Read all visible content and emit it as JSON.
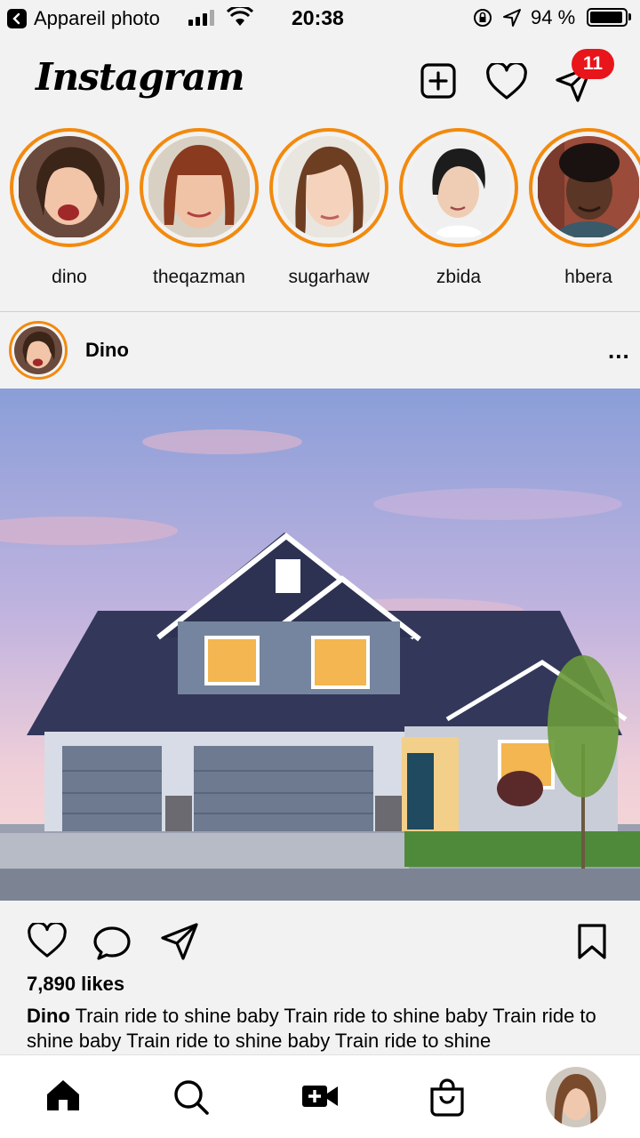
{
  "status_bar": {
    "back_app_label": "Appareil photo",
    "time": "20:38",
    "battery_percent": "94 %",
    "battery_level": 0.94
  },
  "header": {
    "logo": "Instagram",
    "messages_badge": "11"
  },
  "stories": [
    {
      "name": "dino"
    },
    {
      "name": "theqazman"
    },
    {
      "name": "sugarhaw"
    },
    {
      "name": "zbida"
    },
    {
      "name": "hbera"
    }
  ],
  "post": {
    "username": "Dino",
    "more": "...",
    "likes": "7,890 likes",
    "caption_user": "Dino",
    "caption_text": "Train ride to shine baby Train ride to shine baby Train ride to shine baby Train ride to shine baby Train ride to shine"
  },
  "icons": {
    "new_post": "plus-square-icon",
    "activity": "heart-icon",
    "direct": "paper-plane-icon",
    "like": "heart-icon",
    "comment": "comment-icon",
    "share": "paper-plane-icon",
    "save": "bookmark-icon",
    "home": "home-icon",
    "search": "search-icon",
    "reels": "video-plus-icon",
    "shop": "shopping-bag-icon"
  },
  "colors": {
    "story_ring": "#f28a0f",
    "badge": "#e8151b",
    "background": "#f2f2f2"
  }
}
